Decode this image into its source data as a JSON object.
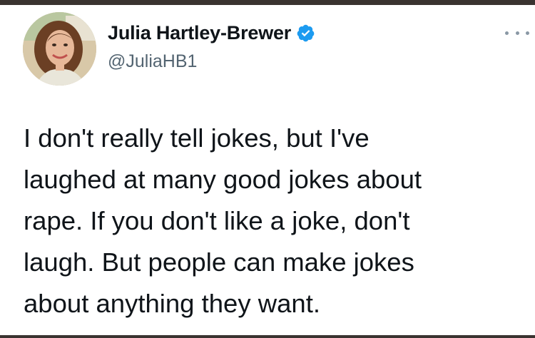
{
  "tweet": {
    "author": {
      "display_name": "Julia Hartley-Brewer",
      "handle": "@JuliaHB1",
      "verified": true
    },
    "text_lines": [
      "I don't really tell jokes, but I've",
      "laughed at many good jokes about",
      "rape. If you don't like a joke, don't",
      "laugh. But people can make jokes",
      "about anything they want."
    ]
  },
  "icons": {
    "verified": "verified-badge-icon",
    "more": "more-options-icon"
  },
  "colors": {
    "verified_blue": "#1d9bf0",
    "text_primary": "#0f1419",
    "text_secondary": "#536471"
  }
}
